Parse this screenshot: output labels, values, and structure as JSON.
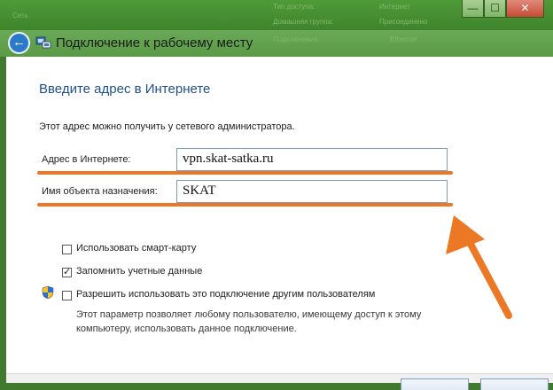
{
  "background_window": {
    "items": [
      "Сеть",
      "Тип доступа:",
      "Интернет",
      "Домашняя группа:",
      "Присоединено",
      "Подключения:",
      "Ethernet"
    ]
  },
  "window": {
    "title": "Подключение к рабочему месту",
    "controls": {
      "minimize": "—",
      "maximize": "☐",
      "close": "✕"
    }
  },
  "page": {
    "heading": "Введите адрес в Интернете",
    "hint": "Этот адрес можно получить у сетевого администратора.",
    "internet_address_label": "Адрес в Интернете:",
    "internet_address_value": "vpn.skat-satka.ru",
    "destination_name_label": "Имя объекта назначения:",
    "destination_name_value": "SKAT"
  },
  "options": {
    "smart_card": {
      "label": "Использовать смарт-карту",
      "checked": false
    },
    "remember": {
      "label": "Запомнить учетные данные",
      "checked": true
    },
    "allow_others": {
      "label": "Разрешить использовать это подключение другим пользователям",
      "checked": false
    },
    "allow_others_note_line1": "Этот параметр позволяет любому пользователю, имеющему доступ к этому",
    "allow_others_note_line2": "компьютеру, использовать данное подключение."
  },
  "colors": {
    "annotation": "#ec7725",
    "heading": "#1f4f8f",
    "window_chrome": "#4f9a38"
  },
  "icons": [
    "back-arrow-icon",
    "network-connection-icon",
    "uac-shield-icon",
    "check-icon"
  ]
}
